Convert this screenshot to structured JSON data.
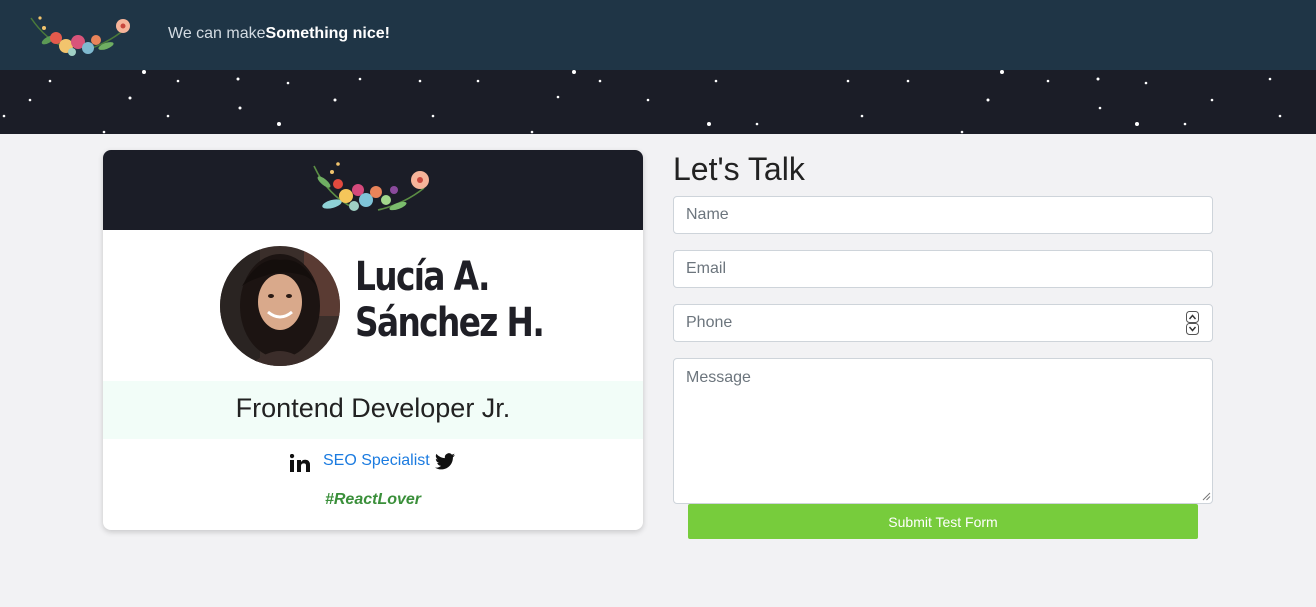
{
  "header": {
    "logo_icon": "floral-wreath-icon",
    "tagline_prefix": "We can make",
    "tagline_bold": "Something nice!"
  },
  "profile": {
    "banner_icon": "floral-wreath-icon",
    "name_line1": "Lucía A.",
    "name_line2": "Sánchez H.",
    "role": "Frontend Developer Jr.",
    "linkedin_icon": "linkedin-icon",
    "link_label": "SEO Specialist",
    "twitter_icon": "twitter-icon",
    "hashtag": "#ReactLover"
  },
  "form": {
    "title": "Let's Talk",
    "name_placeholder": "Name",
    "email_placeholder": "Email",
    "phone_placeholder": "Phone",
    "message_placeholder": "Message",
    "submit_label": "Submit Test Form"
  },
  "colors": {
    "header_bg": "#1f3546",
    "dark_band": "#1b1d27",
    "submit_green": "#77cc3c",
    "link_blue": "#1b7be0",
    "hashtag_green": "#3a8f3a"
  }
}
